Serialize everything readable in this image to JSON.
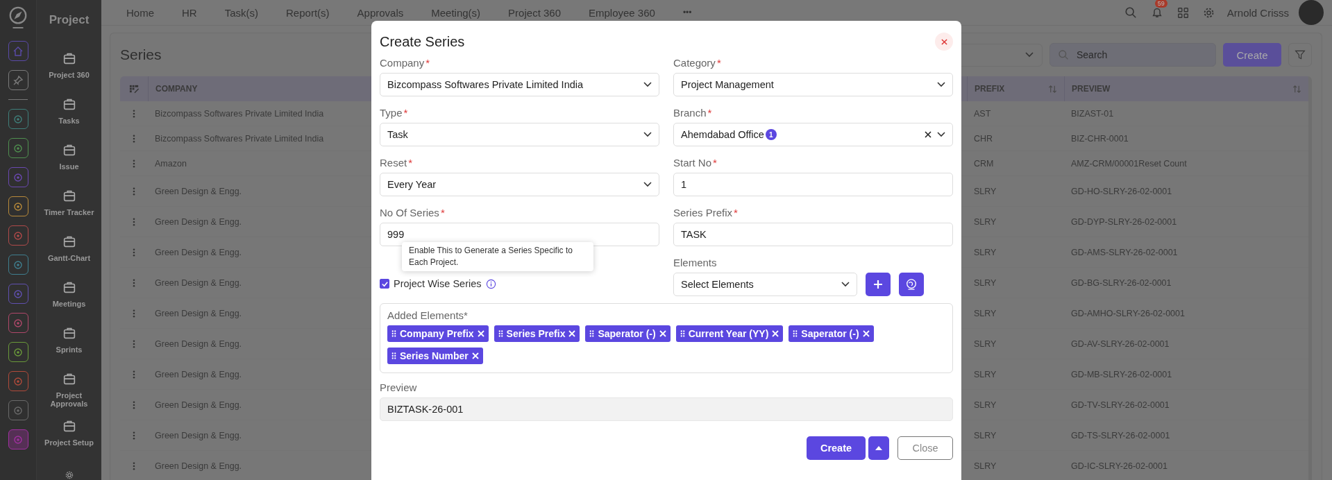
{
  "rail_pinned": [
    {
      "color": "#5a4aa8",
      "selected": false
    },
    {
      "color": "#7a7a7a",
      "selected": false
    }
  ],
  "rail_apps": [
    {
      "color": "#3f7f7a",
      "selected": false
    },
    {
      "color": "#4f8f4f",
      "selected": false
    },
    {
      "color": "#6a48b0",
      "selected": false
    },
    {
      "color": "#b88a3a",
      "selected": false
    },
    {
      "color": "#b04a4a",
      "selected": false
    },
    {
      "color": "#3f7f8f",
      "selected": false
    },
    {
      "color": "#6050b0",
      "selected": false
    },
    {
      "color": "#b0486a",
      "selected": false
    },
    {
      "color": "#6a9a3a",
      "selected": false
    },
    {
      "color": "#b04a3a",
      "selected": false
    },
    {
      "color": "#6a6a6a",
      "selected": false
    },
    {
      "color": "#a030a0",
      "selected": true
    }
  ],
  "module_title": "Project",
  "nav": [
    "Project 360",
    "Tasks",
    "Issue",
    "Timer Tracker",
    "Gantt-Chart",
    "Meetings",
    "Sprints",
    "Project Approvals",
    "Project Setup"
  ],
  "top_menu": [
    "Home",
    "HR",
    "Task(s)",
    "Report(s)",
    "Approvals",
    "Meeting(s)",
    "Project 360",
    "Employee 360"
  ],
  "top_more": "•••",
  "header": {
    "notifications": "59",
    "user": "Arnold Crisss"
  },
  "page": {
    "title": "Series",
    "search": {
      "placeholder": "Search"
    },
    "create": "Create"
  },
  "table": {
    "columns": [
      {
        "label": "COMPANY",
        "sortable": false
      },
      {
        "label": "PREFIX",
        "sortable": true
      },
      {
        "label": "PREVIEW",
        "sortable": true
      }
    ],
    "rows": [
      {
        "company": "Bizcompass Softwares Private Limited India",
        "prefix": "AST",
        "preview": "BIZAST-01"
      },
      {
        "company": "Bizcompass Softwares Private Limited India",
        "prefix": "CHR",
        "preview": "BIZ-CHR-0001"
      },
      {
        "company": "Amazon",
        "prefix": "CRM",
        "preview": "AMZ-CRM/00001Reset Count"
      },
      {
        "company": "Green Design & Engg.",
        "prefix": "SLRY",
        "preview": "GD-HO-SLRY-26-02-0001"
      },
      {
        "company": "Green Design & Engg.",
        "prefix": "SLRY",
        "preview": "GD-DYP-SLRY-26-02-0001"
      },
      {
        "company": "Green Design & Engg.",
        "prefix": "SLRY",
        "preview": "GD-AMS-SLRY-26-02-0001"
      },
      {
        "company": "Green Design & Engg.",
        "prefix": "SLRY",
        "preview": "GD-BG-SLRY-26-02-0001"
      },
      {
        "company": "Green Design & Engg.",
        "prefix": "SLRY",
        "preview": "GD-AMHO-SLRY-26-02-0001"
      },
      {
        "company": "Green Design & Engg.",
        "prefix": "SLRY",
        "preview": "GD-AV-SLRY-26-02-0001"
      },
      {
        "company": "Green Design & Engg.",
        "prefix": "SLRY",
        "preview": "GD-MB-SLRY-26-02-0001"
      },
      {
        "company": "Green Design & Engg.",
        "prefix": "SLRY",
        "preview": "GD-TV-SLRY-26-02-0001"
      },
      {
        "company": "Green Design & Engg.",
        "prefix": "SLRY",
        "preview": "GD-TS-SLRY-26-02-0001"
      },
      {
        "company": "Green Design & Engg.",
        "prefix": "SLRY",
        "preview": "GD-IC-SLRY-26-02-0001"
      }
    ]
  },
  "dialog": {
    "title": "Create Series",
    "required_mark": "*",
    "fields": [
      {
        "label": "Company",
        "required": true,
        "kind": "select",
        "value": "Bizcompass Softwares Private Limited India"
      },
      {
        "label": "Category",
        "required": true,
        "kind": "select",
        "value": "Project Management"
      },
      {
        "label": "Type",
        "required": true,
        "kind": "select",
        "value": "Task"
      },
      {
        "label": "Branch",
        "required": true,
        "kind": "multiselect",
        "value": "Ahemdabad Office",
        "count": "1",
        "clearable": true
      },
      {
        "label": "Reset",
        "required": true,
        "kind": "select",
        "value": "Every Year"
      },
      {
        "label": "Start No",
        "required": true,
        "kind": "text",
        "value": "1"
      },
      {
        "label": "No Of Series",
        "required": true,
        "kind": "text",
        "value": "999"
      },
      {
        "label": "Series Prefix",
        "required": true,
        "kind": "text",
        "value": "TASK"
      }
    ],
    "project_wise": {
      "label": "Project Wise Series",
      "checked": true,
      "tooltip": "Enable This to Generate a Series Specific to Each Project."
    },
    "elements": {
      "label": "Elements",
      "value": "Select Elements"
    },
    "added": {
      "label": "Added Elements*",
      "chips": [
        "Company Prefix",
        "Series Prefix",
        "Saperator (-)",
        "Current Year (YY)",
        "Saperator (-)",
        "Series Number"
      ]
    },
    "preview": {
      "label": "Preview",
      "value": "BIZTASK-26-001"
    },
    "buttons": {
      "create": "Create",
      "close": "Close"
    }
  }
}
